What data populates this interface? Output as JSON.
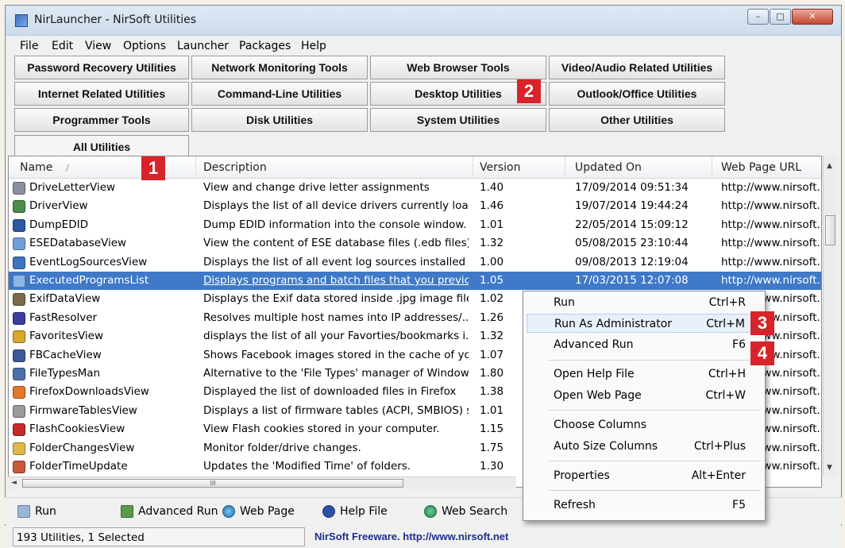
{
  "window": {
    "title": "NirLauncher  -  NirSoft Utilities",
    "minimize": "–",
    "maximize": "□",
    "close": "✕"
  },
  "menu": [
    "File",
    "Edit",
    "View",
    "Options",
    "Launcher",
    "Packages",
    "Help"
  ],
  "categories": {
    "password": "Password Recovery Utilities",
    "network": "Network Monitoring Tools",
    "browser": "Web Browser Tools",
    "video": "Video/Audio Related Utilities",
    "internet": "Internet Related Utilities",
    "cmdline": "Command-Line Utilities",
    "desktop": "Desktop Utilities",
    "outlook": "Outlook/Office Utilities",
    "programmer": "Programmer Tools",
    "disk": "Disk Utilities",
    "system": "System Utilities",
    "other": "Other Utilities",
    "all": "All Utilities"
  },
  "badges": [
    "1",
    "2",
    "3",
    "4"
  ],
  "columns": {
    "name": "Name",
    "sort_indicator": "/",
    "description": "Description",
    "version": "Version",
    "updated": "Updated On",
    "url": "Web Page URL"
  },
  "rows": [
    {
      "name": "DriveLetterView",
      "description": "View and change drive letter assignments",
      "version": "1.40",
      "updated": "17/09/2014 09:51:34",
      "url": "http://www.nirsoft.n",
      "icon_color": "#8a8fa0"
    },
    {
      "name": "DriverView",
      "description": "Displays the list of all device drivers currently load...",
      "version": "1.46",
      "updated": "19/07/2014 19:44:24",
      "url": "http://www.nirsoft.n",
      "icon_color": "#4f8a4a"
    },
    {
      "name": "DumpEDID",
      "description": "Dump EDID information into the console window.",
      "version": "1.01",
      "updated": "22/05/2014 15:09:12",
      "url": "http://www.nirsoft.n",
      "icon_color": "#2e57a6"
    },
    {
      "name": "ESEDatabaseView",
      "description": "View the content of ESE database files (.edb files)",
      "version": "1.32",
      "updated": "05/08/2015 23:10:44",
      "url": "http://www.nirsoft.n",
      "icon_color": "#6f9fd8"
    },
    {
      "name": "EventLogSourcesView",
      "description": "Displays the list of all event log sources installed o...",
      "version": "1.00",
      "updated": "09/08/2013 12:19:04",
      "url": "http://www.nirsoft.n",
      "icon_color": "#3c74c0"
    },
    {
      "name": "ExecutedProgramsList",
      "description": "Displays programs and batch files that you previo...",
      "version": "1.05",
      "updated": "17/03/2015 12:07:08",
      "url": "http://www.nirsoft.n",
      "icon_color": "#8ab6e8"
    },
    {
      "name": "ExifDataView",
      "description": "Displays the Exif data stored inside .jpg image files",
      "version": "1.02",
      "updated": "",
      "url": "http://www.nirsoft.n",
      "icon_color": "#7a6a4a"
    },
    {
      "name": "FastResolver",
      "description": "Resolves multiple host names into IP addresses/...",
      "version": "1.26",
      "updated": "",
      "url": "http://www.nirsoft.n",
      "icon_color": "#3c3c9c"
    },
    {
      "name": "FavoritesView",
      "description": "displays the list of all your Favorties/bookmarks i...",
      "version": "1.32",
      "updated": "",
      "url": "http://www.nirsoft.n",
      "icon_color": "#d6a82c"
    },
    {
      "name": "FBCacheView",
      "description": "Shows Facebook images stored in the cache of yo...",
      "version": "1.07",
      "updated": "",
      "url": "http://www.nirsoft.n",
      "icon_color": "#3b5998"
    },
    {
      "name": "FileTypesMan",
      "description": "Alternative to the 'File Types' manager of Windows.",
      "version": "1.80",
      "updated": "",
      "url": "http://www.nirsoft.n",
      "icon_color": "#4b6fa8"
    },
    {
      "name": "FirefoxDownloadsView",
      "description": "Displayed the list of downloaded files in Firefox",
      "version": "1.38",
      "updated": "",
      "url": "http://www.nirsoft.n",
      "icon_color": "#e0782c"
    },
    {
      "name": "FirmwareTablesView",
      "description": "Displays a list of firmware tables (ACPI, SMBIOS) s...",
      "version": "1.01",
      "updated": "",
      "url": "http://www.nirsoft.n",
      "icon_color": "#9a9a9a"
    },
    {
      "name": "FlashCookiesView",
      "description": "View Flash cookies stored in your computer.",
      "version": "1.15",
      "updated": "",
      "url": "http://www.nirsoft.n",
      "icon_color": "#c42a2a"
    },
    {
      "name": "FolderChangesView",
      "description": "Monitor folder/drive changes.",
      "version": "1.75",
      "updated": "",
      "url": "http://www.nirsoft.n",
      "icon_color": "#e0b84a"
    },
    {
      "name": "FolderTimeUpdate",
      "description": "Updates the 'Modified Time' of folders.",
      "version": "1.30",
      "updated": "",
      "url": "http://www.nirsoft.n",
      "icon_color": "#c85a3a"
    }
  ],
  "scroll": {
    "thumb_grip": "III",
    "left": "◄",
    "right": "►",
    "up": "▲",
    "down": "▼"
  },
  "context_menu": [
    {
      "label": "Run",
      "shortcut": "Ctrl+R"
    },
    {
      "label": "Run As Administrator",
      "shortcut": "Ctrl+M"
    },
    {
      "label": "Advanced Run",
      "shortcut": "F6"
    },
    {
      "label": "Open Help File",
      "shortcut": "Ctrl+H"
    },
    {
      "label": "Open Web Page",
      "shortcut": "Ctrl+W"
    },
    {
      "label": "Choose Columns",
      "shortcut": ""
    },
    {
      "label": "Auto Size Columns",
      "shortcut": "Ctrl+Plus"
    },
    {
      "label": "Properties",
      "shortcut": "Alt+Enter"
    },
    {
      "label": "Refresh",
      "shortcut": "F5"
    }
  ],
  "toolbar": {
    "run": "Run",
    "advanced_run": "Advanced Run",
    "web_page": "Web Page",
    "help_file": "Help File",
    "web_search": "Web Search"
  },
  "status": {
    "count": "193 Utilities, 1 Selected",
    "freeware": "NirSoft Freeware.  http://www.nirsoft.net"
  },
  "colors": {
    "selection": "#3f79c7",
    "badge": "#d8232a",
    "link": "#1c2e8c"
  }
}
